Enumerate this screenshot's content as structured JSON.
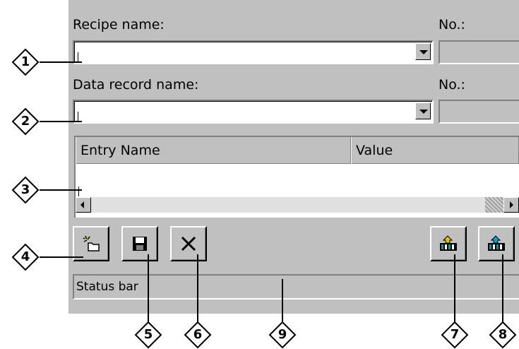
{
  "recipe": {
    "label": "Recipe name:",
    "value": "",
    "no_label": "No.:"
  },
  "record": {
    "label": "Data record name:",
    "value": "",
    "no_label": "No.:"
  },
  "table": {
    "columns": [
      "Entry Name",
      "Value"
    ]
  },
  "toolbar": {
    "buttons": [
      {
        "name": "new-button",
        "icon": "new-icon"
      },
      {
        "name": "save-button",
        "icon": "save-icon"
      },
      {
        "name": "delete-button",
        "icon": "delete-icon"
      },
      {
        "name": "load-to-plc-button",
        "icon": "transfer-icon"
      },
      {
        "name": "save-from-plc-button",
        "icon": "transfer-icon"
      }
    ]
  },
  "status": {
    "text": "Status bar"
  },
  "callouts": [
    "1",
    "2",
    "3",
    "4",
    "5",
    "6",
    "7",
    "8",
    "9"
  ]
}
